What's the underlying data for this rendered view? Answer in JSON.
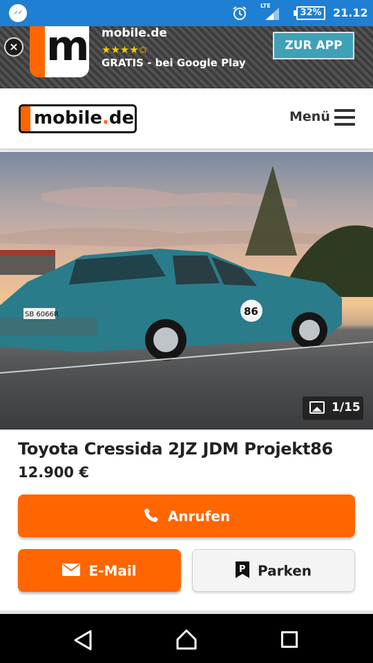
{
  "status_bar": {
    "network": "LTE",
    "battery": "32%",
    "time": "21.12",
    "icons": [
      "messenger-icon",
      "alarm-icon",
      "signal-icon",
      "battery-icon"
    ]
  },
  "ad": {
    "app_name": "mobile.de",
    "logo_letter": "m",
    "stars": "★★★★✩",
    "subtitle": "GRATIS - bei Google Play",
    "cta_label": "ZUR APP",
    "close_glyph": "×"
  },
  "header": {
    "logo_main": "mobile",
    "logo_dot": ".",
    "logo_suffix": "de",
    "menu_label": "Menü"
  },
  "gallery": {
    "counter": "1/15"
  },
  "listing": {
    "title": "Toyota Cressida 2JZ JDM Projekt86",
    "price": "12.900 €"
  },
  "actions": {
    "call_label": "Anrufen",
    "email_label": "E-Mail",
    "park_label": "Parken"
  },
  "colors": {
    "status_bar": "#1e7fd3",
    "brand_orange": "#ff6600",
    "ad_cta": "#3fa0b8"
  }
}
